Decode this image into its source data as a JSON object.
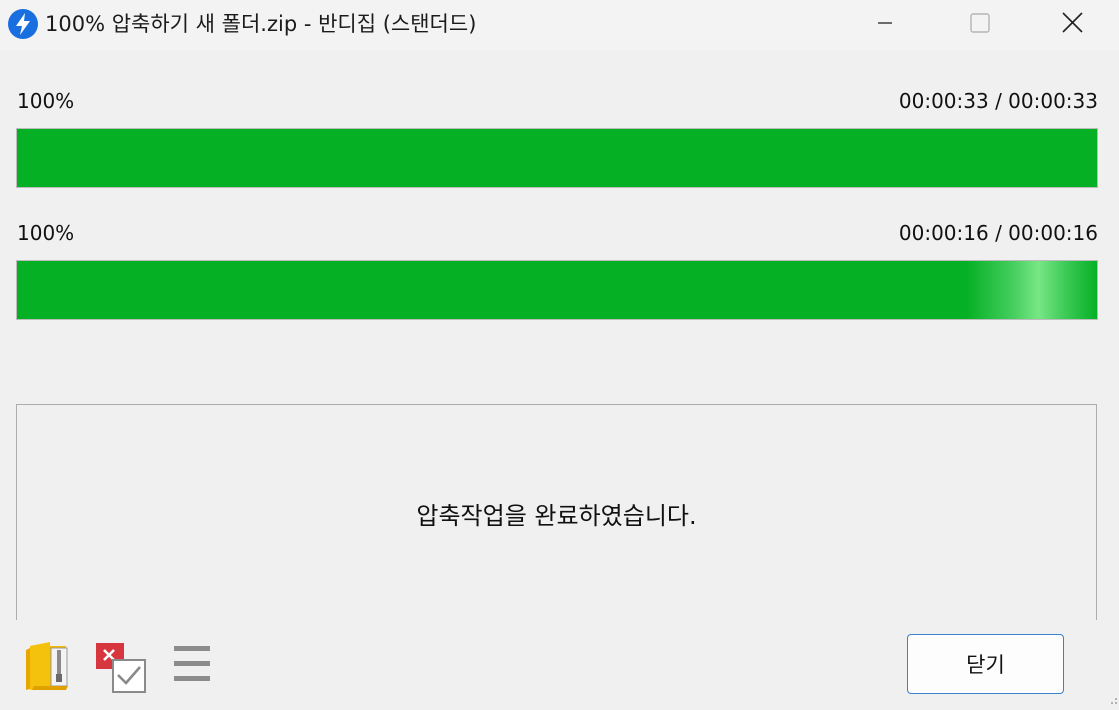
{
  "window": {
    "title": "100% 압축하기 새 폴더.zip - 반디집 (스탠더드)"
  },
  "progress": [
    {
      "percent_label": "100%",
      "time": "00:00:33 / 00:00:33",
      "value": 1.0
    },
    {
      "percent_label": "100%",
      "time": "00:00:16 / 00:00:16",
      "value": 1.0
    }
  ],
  "message": "압축작업을 완료하였습니다.",
  "buttons": {
    "close_label": "닫기"
  },
  "toolbar": {
    "icons": [
      "open-folder-icon",
      "delete-after-icon",
      "menu-icon"
    ]
  },
  "colors": {
    "progress_fill": "#06b025",
    "app_icon": "#1a6fe0",
    "button_border": "#3a82c9"
  }
}
